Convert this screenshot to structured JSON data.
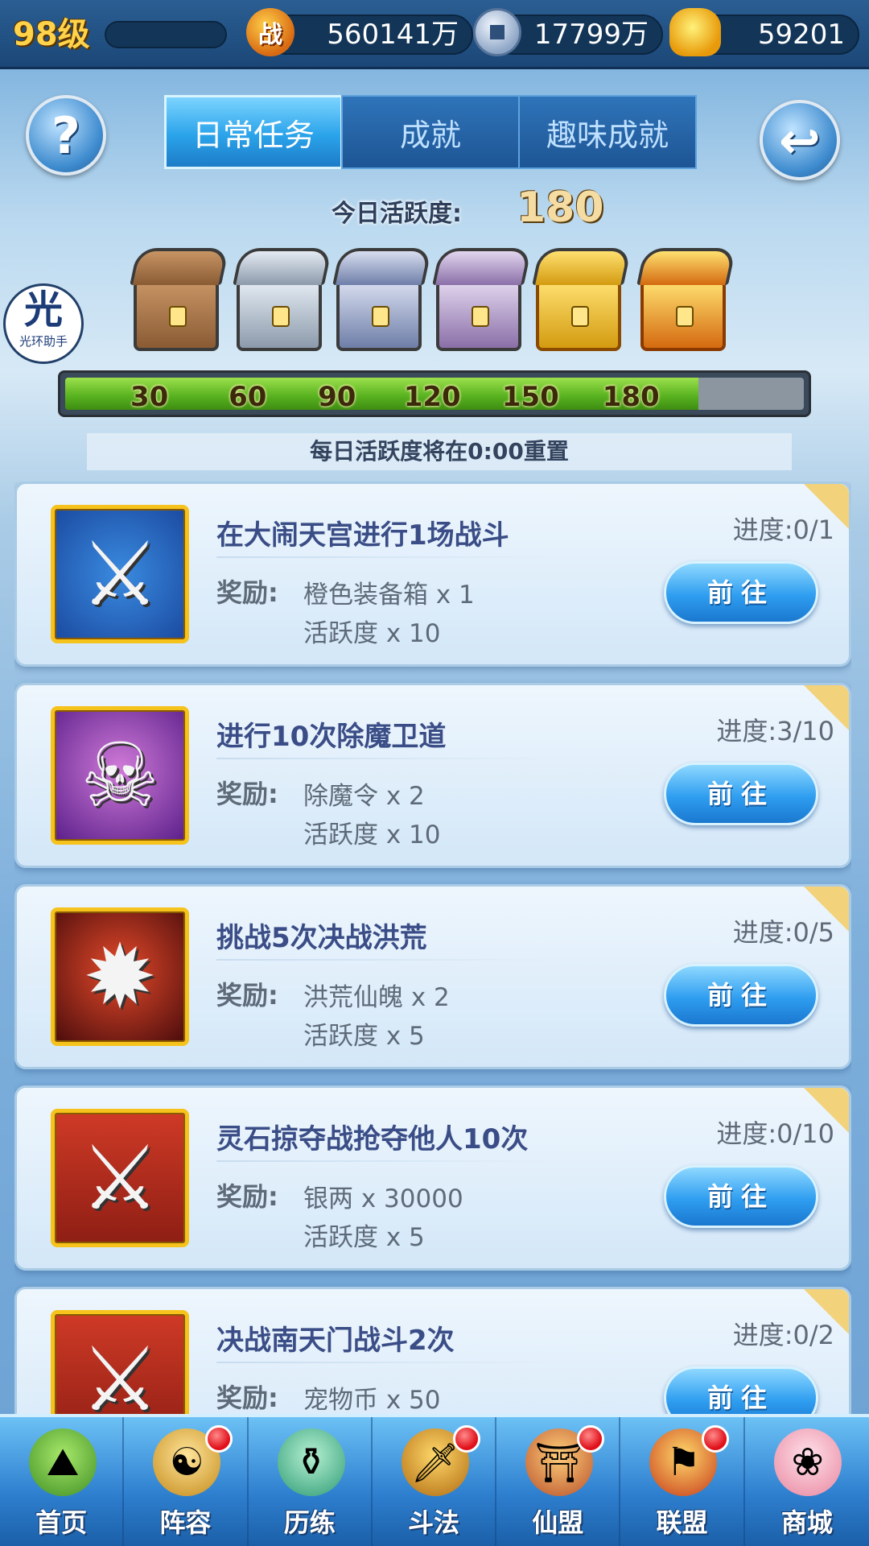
{
  "topbar": {
    "level": "98级",
    "battle_icon_text": "战",
    "power": "560141万",
    "coins": "17799万",
    "gold": "59201"
  },
  "header": {
    "help_symbol": "?",
    "back_symbol": "↩",
    "tabs": [
      "日常任务",
      "成就",
      "趣味成就"
    ],
    "active_tab": 0
  },
  "watermark": {
    "main": "光",
    "sub": "光环助手"
  },
  "activity": {
    "label": "今日活跃度:",
    "value": "180",
    "current": 180,
    "max": 210,
    "milestones": [
      "30",
      "60",
      "90",
      "120",
      "150",
      "180"
    ],
    "reset_note": "每日活跃度将在0:00重置"
  },
  "tasks": [
    {
      "title": "在大闹天宫进行1场战斗",
      "reward_label": "奖励:",
      "rewards": [
        "橙色装备箱 x 1",
        "活跃度 x 10"
      ],
      "progress": "进度:0/1",
      "button": "前往",
      "icon": "sword-icon"
    },
    {
      "title": "进行10次除魔卫道",
      "reward_label": "奖励:",
      "rewards": [
        "除魔令 x 2",
        "活跃度 x 10"
      ],
      "progress": "进度:3/10",
      "button": "前往",
      "icon": "demon-mask-icon"
    },
    {
      "title": "挑战5次决战洪荒",
      "reward_label": "奖励:",
      "rewards": [
        "洪荒仙魄 x 2",
        "活跃度 x 5"
      ],
      "progress": "进度:0/5",
      "button": "前往",
      "icon": "orb-icon"
    },
    {
      "title": "灵石掠夺战抢夺他人10次",
      "reward_label": "奖励:",
      "rewards": [
        "银两 x 30000",
        "活跃度 x 5"
      ],
      "progress": "进度:0/10",
      "button": "前往",
      "icon": "crossed-swords-icon"
    },
    {
      "title": "决战南天门战斗2次",
      "reward_label": "奖励:",
      "rewards": [
        "宠物币 x 50",
        ""
      ],
      "progress": "进度:0/2",
      "button": "前往",
      "icon": "crossed-swords-icon"
    }
  ],
  "nav": [
    {
      "label": "首页",
      "badge": false
    },
    {
      "label": "阵容",
      "badge": true
    },
    {
      "label": "历练",
      "badge": false
    },
    {
      "label": "斗法",
      "badge": true
    },
    {
      "label": "仙盟",
      "badge": true
    },
    {
      "label": "联盟",
      "badge": true
    },
    {
      "label": "商城",
      "badge": false
    }
  ]
}
